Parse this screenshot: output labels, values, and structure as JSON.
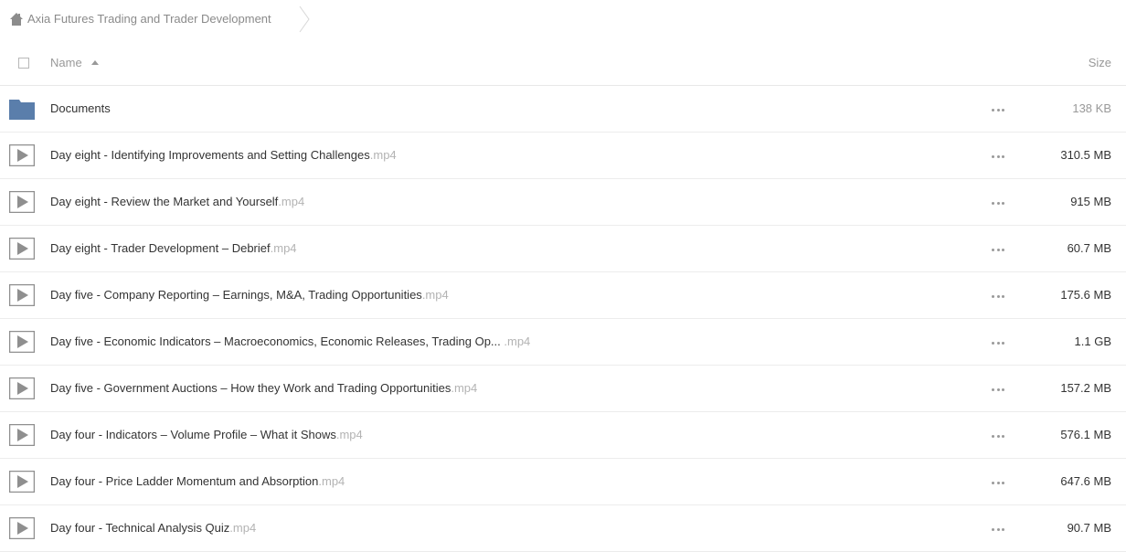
{
  "breadcrumb": {
    "title": "Axia Futures Trading and Trader Development"
  },
  "header": {
    "name_label": "Name",
    "size_label": "Size"
  },
  "rows": [
    {
      "icon": "folder-icon",
      "name": "Documents",
      "ext": "",
      "size": "138 KB"
    },
    {
      "icon": "video-icon",
      "name": "Day eight - Identifying Improvements and Setting Challenges",
      "ext": ".mp4",
      "size": "310.5 MB"
    },
    {
      "icon": "video-icon",
      "name": "Day eight - Review the Market and Yourself",
      "ext": ".mp4",
      "size": "915 MB"
    },
    {
      "icon": "video-icon",
      "name": "Day eight - Trader Development – Debrief",
      "ext": ".mp4",
      "size": "60.7 MB"
    },
    {
      "icon": "video-icon",
      "name": "Day five - Company Reporting – Earnings, M&A, Trading Opportunities",
      "ext": ".mp4",
      "size": "175.6 MB"
    },
    {
      "icon": "video-icon",
      "name": "Day five - Economic Indicators – Macroeconomics, Economic Releases, Trading Op... ",
      "ext": ".mp4",
      "size": "1.1 GB"
    },
    {
      "icon": "video-icon",
      "name": "Day five - Government Auctions – How they Work and Trading Opportunities",
      "ext": ".mp4",
      "size": "157.2 MB"
    },
    {
      "icon": "video-icon",
      "name": "Day four - Indicators – Volume Profile – What it Shows",
      "ext": ".mp4",
      "size": "576.1 MB"
    },
    {
      "icon": "video-icon",
      "name": "Day four - Price Ladder Momentum and Absorption",
      "ext": ".mp4",
      "size": "647.6 MB"
    },
    {
      "icon": "video-icon",
      "name": "Day four - Technical Analysis Quiz",
      "ext": ".mp4",
      "size": "90.7 MB"
    }
  ],
  "colors": {
    "folder": "#5a7eab",
    "video_icon": "#8f8f8f",
    "muted_text": "#999999",
    "extension_text": "#b3b3b3"
  }
}
